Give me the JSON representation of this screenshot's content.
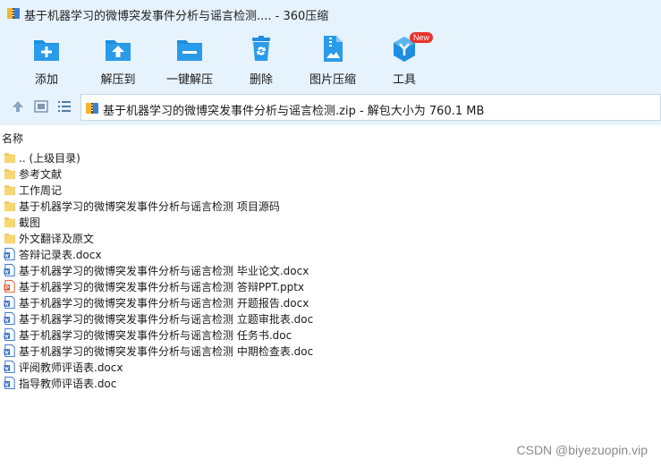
{
  "window": {
    "title": "基于机器学习的微博突发事件分析与谣言检测.... - 360压缩"
  },
  "toolbar": {
    "items": [
      {
        "label": "添加",
        "icon": "add-icon"
      },
      {
        "label": "解压到",
        "icon": "extract-to-icon"
      },
      {
        "label": "一键解压",
        "icon": "one-click-extract-icon"
      },
      {
        "label": "删除",
        "icon": "delete-icon"
      },
      {
        "label": "图片压缩",
        "icon": "image-compress-icon"
      },
      {
        "label": "工具",
        "icon": "tools-icon",
        "badge": "New"
      }
    ]
  },
  "address": {
    "path": "基于机器学习的微博突发事件分析与谣言检测.zip - 解包大小为 760.1 MB"
  },
  "list": {
    "column_name": "名称",
    "items": [
      {
        "label": ".. (上级目录)",
        "type": "folder"
      },
      {
        "label": "参考文献",
        "type": "folder"
      },
      {
        "label": "工作周记",
        "type": "folder"
      },
      {
        "label": "基于机器学习的微博突发事件分析与谣言检测 项目源码",
        "type": "folder"
      },
      {
        "label": "截图",
        "type": "folder"
      },
      {
        "label": "外文翻译及原文",
        "type": "folder"
      },
      {
        "label": "答辩记录表.docx",
        "type": "word"
      },
      {
        "label": "基于机器学习的微博突发事件分析与谣言检测 毕业论文.docx",
        "type": "word"
      },
      {
        "label": "基于机器学习的微博突发事件分析与谣言检测 答辩PPT.pptx",
        "type": "ppt"
      },
      {
        "label": "基于机器学习的微博突发事件分析与谣言检测 开题报告.docx",
        "type": "word"
      },
      {
        "label": "基于机器学习的微博突发事件分析与谣言检测 立题审批表.doc",
        "type": "word"
      },
      {
        "label": "基于机器学习的微博突发事件分析与谣言检测 任务书.doc",
        "type": "word"
      },
      {
        "label": "基于机器学习的微博突发事件分析与谣言检测 中期检查表.doc",
        "type": "word"
      },
      {
        "label": "评阅教师评语表.docx",
        "type": "word"
      },
      {
        "label": "指导教师评语表.doc",
        "type": "word"
      }
    ]
  },
  "watermark": "CSDN @biyezuopin.vip",
  "colors": {
    "chrome_bg": "#e6f2fc",
    "accent_blue": "#1e8ee0",
    "folder_yellow": "#f7d774",
    "word_blue": "#2b6cc4",
    "ppt_orange": "#d9542b",
    "badge_red": "#e8322a"
  }
}
